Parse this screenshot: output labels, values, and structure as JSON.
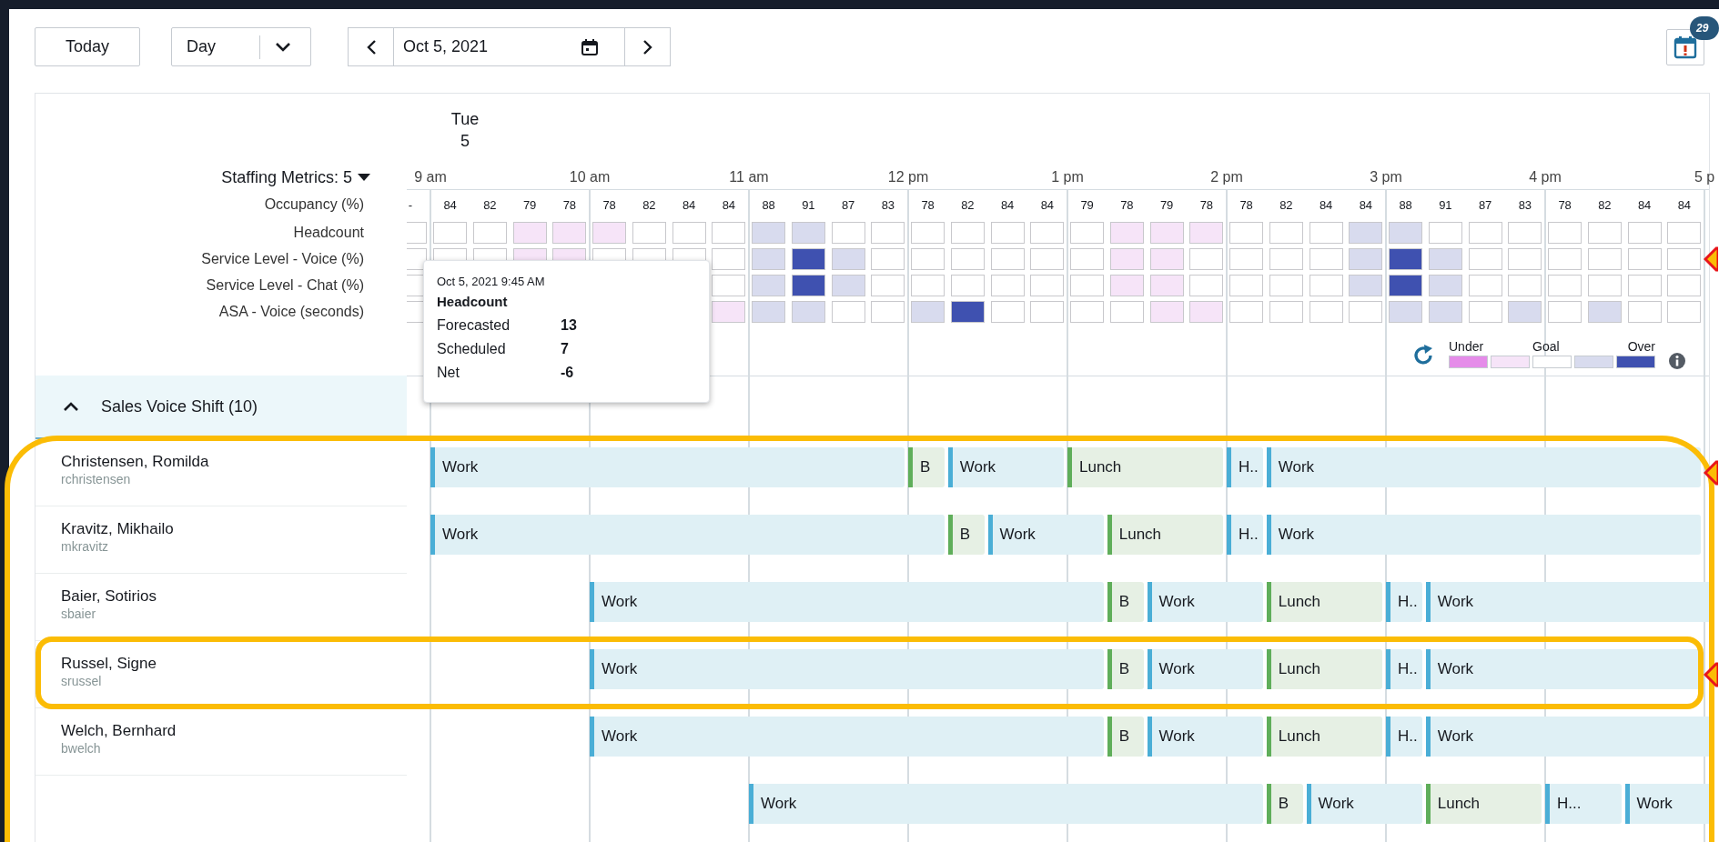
{
  "toolbar": {
    "today": "Today",
    "view": "Day",
    "date": "Oct 5, 2021",
    "alerts_badge": "29"
  },
  "day_header": {
    "weekday": "Tue",
    "day": "5"
  },
  "time_labels": [
    "9 am",
    "10 am",
    "11 am",
    "12 pm",
    "1 pm",
    "2 pm",
    "3 pm",
    "4 pm",
    "5 p"
  ],
  "staffing_metrics": {
    "title": "Staffing Metrics: 5",
    "occupancy": {
      "label": "Occupancy (%)",
      "values": [
        "-",
        "84",
        "82",
        "79",
        "78",
        "78",
        "82",
        "84",
        "84",
        "88",
        "91",
        "87",
        "83",
        "78",
        "82",
        "84",
        "84",
        "79",
        "78",
        "79",
        "78",
        "78",
        "82",
        "84",
        "84",
        "88",
        "91",
        "87",
        "83",
        "78",
        "82",
        "84",
        "84"
      ]
    },
    "rows": [
      {
        "label": "Headcount",
        "pointer": false,
        "cells": [
          {
            "color": "#ffffff"
          },
          {
            "color": "#ffffff"
          },
          {
            "color": "#ffffff"
          },
          {
            "color": "#f6e4f8"
          },
          {
            "color": "#f6e4f8"
          },
          {
            "color": "#f6e4f8"
          },
          {
            "color": "#ffffff"
          },
          {
            "color": "#ffffff"
          },
          {
            "color": "#ffffff"
          },
          {
            "color": "#d8dbee"
          },
          {
            "color": "#d8dbee"
          },
          {
            "color": "#ffffff"
          },
          {
            "color": "#ffffff"
          },
          {
            "color": "#ffffff"
          },
          {
            "color": "#ffffff"
          },
          {
            "color": "#ffffff"
          },
          {
            "color": "#ffffff"
          },
          {
            "color": "#ffffff"
          },
          {
            "color": "#f6e4f8"
          },
          {
            "color": "#f6e4f8"
          },
          {
            "color": "#f6e4f8"
          },
          {
            "color": "#ffffff"
          },
          {
            "color": "#ffffff"
          },
          {
            "color": "#ffffff"
          },
          {
            "color": "#d8dbee"
          },
          {
            "color": "#d8dbee"
          },
          {
            "color": "#ffffff"
          },
          {
            "color": "#ffffff"
          },
          {
            "color": "#ffffff"
          },
          {
            "color": "#ffffff"
          },
          {
            "color": "#ffffff"
          },
          {
            "color": "#ffffff"
          },
          {
            "color": "#ffffff"
          }
        ]
      },
      {
        "label": "Service Level - Voice (%)",
        "pointer": true,
        "cells": [
          {
            "color": "#ffffff"
          },
          {
            "color": "#ffffff"
          },
          {
            "color": "#ffffff"
          },
          {
            "color": "#f6e4f8"
          },
          {
            "color": "#f6e4f8"
          },
          {
            "color": "#ffffff"
          },
          {
            "color": "#ffffff"
          },
          {
            "color": "#ffffff"
          },
          {
            "color": "#ffffff"
          },
          {
            "color": "#d8dbee"
          },
          {
            "color": "#3f51b0"
          },
          {
            "color": "#d8dbee"
          },
          {
            "color": "#ffffff"
          },
          {
            "color": "#ffffff"
          },
          {
            "color": "#ffffff"
          },
          {
            "color": "#ffffff"
          },
          {
            "color": "#ffffff"
          },
          {
            "color": "#ffffff"
          },
          {
            "color": "#f6e4f8"
          },
          {
            "color": "#f6e4f8"
          },
          {
            "color": "#ffffff"
          },
          {
            "color": "#ffffff"
          },
          {
            "color": "#ffffff"
          },
          {
            "color": "#ffffff"
          },
          {
            "color": "#d8dbee"
          },
          {
            "color": "#3f51b0"
          },
          {
            "color": "#d8dbee"
          },
          {
            "color": "#ffffff"
          },
          {
            "color": "#ffffff"
          },
          {
            "color": "#ffffff"
          },
          {
            "color": "#ffffff"
          },
          {
            "color": "#ffffff"
          },
          {
            "color": "#ffffff"
          }
        ]
      },
      {
        "label": "Service Level - Chat (%)",
        "pointer": false,
        "cells": [
          {
            "color": "#ffffff"
          },
          null,
          null,
          null,
          null,
          null,
          null,
          null,
          {
            "color": "#ffffff"
          },
          {
            "color": "#d8dbee"
          },
          {
            "color": "#3f51b0"
          },
          {
            "color": "#d8dbee"
          },
          {
            "color": "#ffffff"
          },
          {
            "color": "#ffffff"
          },
          {
            "color": "#ffffff"
          },
          {
            "color": "#ffffff"
          },
          {
            "color": "#ffffff"
          },
          {
            "color": "#ffffff"
          },
          {
            "color": "#f6e4f8"
          },
          {
            "color": "#f6e4f8"
          },
          {
            "color": "#ffffff"
          },
          {
            "color": "#ffffff"
          },
          {
            "color": "#ffffff"
          },
          {
            "color": "#ffffff"
          },
          {
            "color": "#d8dbee"
          },
          {
            "color": "#3f51b0"
          },
          {
            "color": "#d8dbee"
          },
          {
            "color": "#ffffff"
          },
          {
            "color": "#ffffff"
          },
          {
            "color": "#ffffff"
          },
          {
            "color": "#ffffff"
          },
          {
            "color": "#ffffff"
          },
          {
            "color": "#ffffff"
          }
        ]
      },
      {
        "label": "ASA - Voice (seconds)",
        "pointer": false,
        "cells": [
          {
            "color": "#ffffff"
          },
          null,
          null,
          null,
          null,
          null,
          null,
          null,
          {
            "color": "#f6e4f8"
          },
          {
            "color": "#d8dbee"
          },
          {
            "color": "#d8dbee"
          },
          {
            "color": "#ffffff"
          },
          {
            "color": "#ffffff"
          },
          {
            "color": "#d8dbee"
          },
          {
            "color": "#3f51b0"
          },
          {
            "color": "#ffffff"
          },
          {
            "color": "#ffffff"
          },
          {
            "color": "#ffffff"
          },
          {
            "color": "#ffffff"
          },
          {
            "color": "#f6e4f8"
          },
          {
            "color": "#f6e4f8"
          },
          {
            "color": "#ffffff"
          },
          {
            "color": "#ffffff"
          },
          {
            "color": "#ffffff"
          },
          {
            "color": "#ffffff"
          },
          {
            "color": "#d8dbee"
          },
          {
            "color": "#d8dbee"
          },
          {
            "color": "#ffffff"
          },
          {
            "color": "#d8dbee"
          },
          {
            "color": "#ffffff"
          },
          {
            "color": "#d8dbee"
          },
          {
            "color": "#ffffff"
          },
          {
            "color": "#ffffff"
          }
        ]
      }
    ]
  },
  "tooltip": {
    "datetime": "Oct 5, 2021 9:45 AM",
    "metric": "Headcount",
    "rows": [
      {
        "label": "Forecasted",
        "value": "13"
      },
      {
        "label": "Scheduled",
        "value": "7"
      },
      {
        "label": "Net",
        "value": "-6"
      }
    ]
  },
  "legend": {
    "under": "Under",
    "goal": "Goal",
    "over": "Over",
    "swatches": [
      {
        "color": "#e58ce9"
      },
      {
        "color": "#f6e4f8"
      },
      {
        "color": "#ffffff"
      },
      {
        "color": "#d8dbee"
      },
      {
        "color": "#3f51b0"
      }
    ]
  },
  "group": {
    "title": "Sales Voice Shift (10)",
    "expanded": true,
    "outlined": true
  },
  "agents": [
    {
      "name": "Christensen, Romilda",
      "username": "rchristensen",
      "outlined": false,
      "pointer": true,
      "segments": [
        {
          "kind": "work",
          "label": "Work"
        },
        {
          "kind": "break",
          "label": "B"
        },
        {
          "kind": "work",
          "label": "Work"
        },
        {
          "kind": "break",
          "label": "Lunch"
        },
        {
          "kind": "work",
          "label": "H.."
        },
        {
          "kind": "work",
          "label": "Work"
        }
      ]
    },
    {
      "name": "Kravitz, Mikhailo",
      "username": "mkravitz",
      "outlined": false,
      "pointer": false,
      "segments": [
        {
          "kind": "work",
          "label": "Work"
        },
        {
          "kind": "break",
          "label": "B"
        },
        {
          "kind": "work",
          "label": "Work"
        },
        {
          "kind": "break",
          "label": "Lunch"
        },
        {
          "kind": "work",
          "label": "H.."
        },
        {
          "kind": "work",
          "label": "Work"
        }
      ]
    },
    {
      "name": "Baier, Sotirios",
      "username": "sbaier",
      "outlined": false,
      "pointer": false,
      "segments": [
        {
          "kind": "work",
          "label": "Work"
        },
        {
          "kind": "break",
          "label": "B"
        },
        {
          "kind": "work",
          "label": "Work"
        },
        {
          "kind": "break",
          "label": "Lunch"
        },
        {
          "kind": "work",
          "label": "H.."
        },
        {
          "kind": "work",
          "label": "Work"
        }
      ]
    },
    {
      "name": "Russel, Signe",
      "username": "srussel",
      "outlined": true,
      "pointer": true,
      "segments": [
        {
          "kind": "work",
          "label": "Work"
        },
        {
          "kind": "break",
          "label": "B"
        },
        {
          "kind": "work",
          "label": "Work"
        },
        {
          "kind": "break",
          "label": "Lunch"
        },
        {
          "kind": "work",
          "label": "H.."
        },
        {
          "kind": "work",
          "label": "Work"
        }
      ]
    },
    {
      "name": "Welch, Bernhard",
      "username": "bwelch",
      "outlined": false,
      "pointer": false,
      "segments": [
        {
          "kind": "work",
          "label": "Work"
        },
        {
          "kind": "break",
          "label": "B"
        },
        {
          "kind": "work",
          "label": "Work"
        },
        {
          "kind": "break",
          "label": "Lunch"
        },
        {
          "kind": "work",
          "label": "H.."
        },
        {
          "kind": "work",
          "label": "Work"
        }
      ]
    },
    {
      "outlined": false,
      "pointer": false,
      "segments": [
        {
          "kind": "work",
          "label": "Work"
        },
        {
          "kind": "break",
          "label": "B"
        },
        {
          "kind": "work",
          "label": "Work"
        },
        {
          "kind": "break",
          "label": "Lunch"
        },
        {
          "kind": "work",
          "label": "H..."
        },
        {
          "kind": "work",
          "label": "Work"
        }
      ]
    }
  ]
}
